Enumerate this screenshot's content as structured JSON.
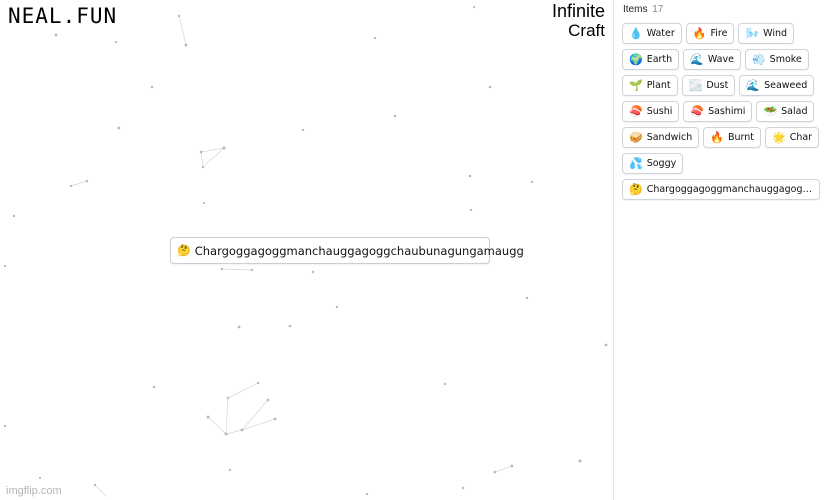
{
  "branding": {
    "site_logo": "NEAL.FUN",
    "game_logo_line1": "Infinite",
    "game_logo_line2": "Craft"
  },
  "canvas": {
    "item": {
      "icon": "thinking-face-icon",
      "emoji": "🤔",
      "label": "Chargoggagoggmanchauggagoggchaubunagungamaugg"
    }
  },
  "sidebar": {
    "header_label": "Items",
    "count": "17",
    "items": [
      {
        "emoji": "💧",
        "icon": "droplet-icon",
        "label": "Water"
      },
      {
        "emoji": "🔥",
        "icon": "fire-icon",
        "label": "Fire"
      },
      {
        "emoji": "🌬️",
        "icon": "wind-icon",
        "label": "Wind"
      },
      {
        "emoji": "🌍",
        "icon": "globe-icon",
        "label": "Earth"
      },
      {
        "emoji": "🌊",
        "icon": "wave-icon",
        "label": "Wave"
      },
      {
        "emoji": "💨",
        "icon": "smoke-icon",
        "label": "Smoke"
      },
      {
        "emoji": "🌱",
        "icon": "seedling-icon",
        "label": "Plant"
      },
      {
        "emoji": "🌫️",
        "icon": "dust-icon",
        "label": "Dust"
      },
      {
        "emoji": "🌊",
        "icon": "wave-icon",
        "label": "Seaweed"
      },
      {
        "emoji": "🍣",
        "icon": "sushi-icon",
        "label": "Sushi"
      },
      {
        "emoji": "🍣",
        "icon": "sushi-icon",
        "label": "Sashimi"
      },
      {
        "emoji": "🥗",
        "icon": "salad-icon",
        "label": "Salad"
      },
      {
        "emoji": "🥪",
        "icon": "sandwich-icon",
        "label": "Sandwich"
      },
      {
        "emoji": "🔥",
        "icon": "fire-icon",
        "label": "Burnt"
      },
      {
        "emoji": "🌟",
        "icon": "star-icon",
        "label": "Char"
      },
      {
        "emoji": "💦",
        "icon": "sweat-droplets-icon",
        "label": "Soggy"
      },
      {
        "emoji": "🤔",
        "icon": "thinking-face-icon",
        "label": "Chargoggagoggmanchauggagoggc..."
      }
    ]
  },
  "watermark": "imgflip.com",
  "colors": {
    "border": "#cfd4da",
    "star": "#b9b9b9",
    "background": "#ffffff"
  }
}
